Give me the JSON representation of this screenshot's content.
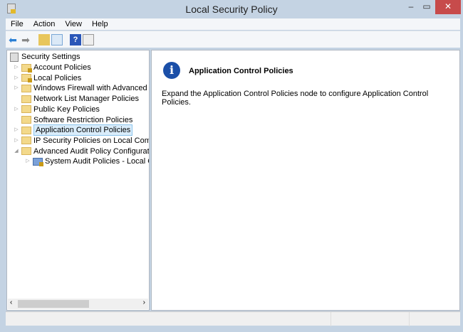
{
  "window": {
    "title": "Local Security Policy",
    "minimize": "–",
    "maximize": "▭",
    "close": "✕"
  },
  "menu": [
    "File",
    "Action",
    "View",
    "Help"
  ],
  "tree": {
    "root": "Security Settings",
    "items": [
      {
        "label": "Account Policies",
        "expander": "▷",
        "lock": true
      },
      {
        "label": "Local Policies",
        "expander": "▷",
        "lock": true
      },
      {
        "label": "Windows Firewall with Advanced Secu",
        "expander": "▷"
      },
      {
        "label": "Network List Manager Policies",
        "expander": ""
      },
      {
        "label": "Public Key Policies",
        "expander": "▷"
      },
      {
        "label": "Software Restriction Policies",
        "expander": ""
      },
      {
        "label": "Application Control Policies",
        "expander": "▷",
        "selected": true
      },
      {
        "label": "IP Security Policies on Local Compute",
        "expander": "▷"
      },
      {
        "label": "Advanced Audit Policy Configuration",
        "expander": "◢"
      }
    ],
    "child": "System Audit Policies - Local Grou"
  },
  "content": {
    "heading": "Application Control Policies",
    "description": "Expand the Application Control Policies node to configure Application Control Policies."
  }
}
